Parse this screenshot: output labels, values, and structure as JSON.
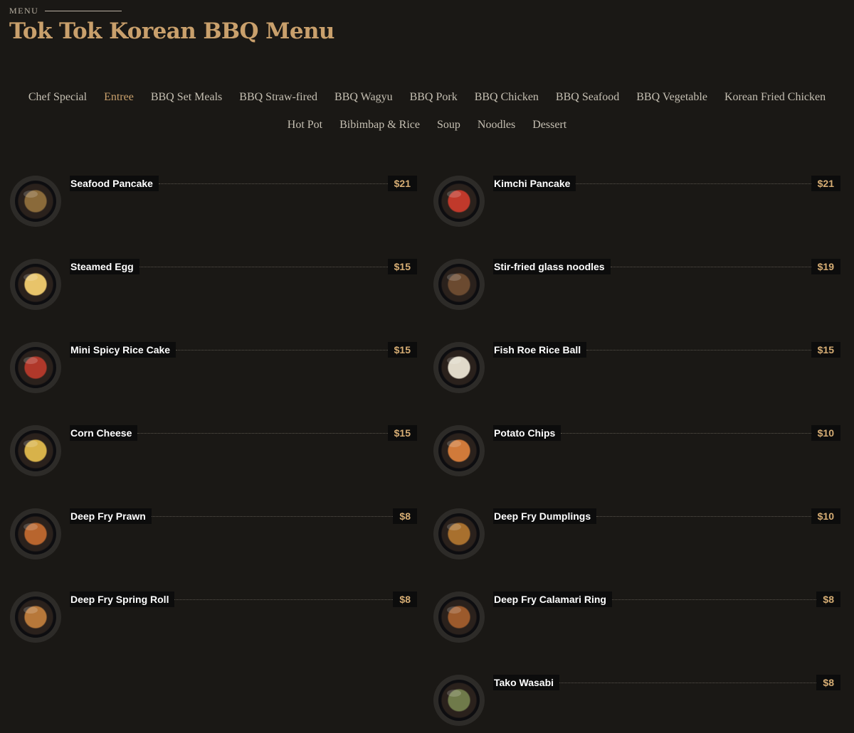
{
  "header": {
    "eyebrow": "MENU",
    "title": "Tok Tok Korean BBQ Menu"
  },
  "nav": {
    "row1": [
      "Chef Special",
      "Entree",
      "BBQ Set Meals",
      "BBQ Straw-fired",
      "BBQ Wagyu",
      "BBQ Pork",
      "BBQ Chicken",
      "BBQ Seafood",
      "BBQ Vegetable",
      "Korean Fried Chicken"
    ],
    "row2": [
      "Hot Pot",
      "Bibimbap & Rice",
      "Soup",
      "Noodles",
      "Dessert"
    ],
    "active": "Entree"
  },
  "items": [
    {
      "name": "Seafood Pancake",
      "price": "$21",
      "food": "#8a6a3a"
    },
    {
      "name": "Kimchi Pancake",
      "price": "$21",
      "food": "#c0392b"
    },
    {
      "name": "Steamed Egg",
      "price": "$15",
      "food": "#e8c46a"
    },
    {
      "name": "Stir-fried glass noodles",
      "price": "$19",
      "food": "#6b4a30"
    },
    {
      "name": "Mini Spicy Rice Cake",
      "price": "$15",
      "food": "#b0382a"
    },
    {
      "name": "Fish Roe Rice Ball",
      "price": "$15",
      "food": "#e0d9c9"
    },
    {
      "name": "Corn Cheese",
      "price": "$15",
      "food": "#d8b24a"
    },
    {
      "name": "Potato Chips",
      "price": "$10",
      "food": "#d07a3a"
    },
    {
      "name": "Deep Fry Prawn",
      "price": "$8",
      "food": "#b8652e"
    },
    {
      "name": "Deep Fry Dumplings",
      "price": "$10",
      "food": "#a8702e"
    },
    {
      "name": "Deep Fry Spring Roll",
      "price": "$8",
      "food": "#b7783a"
    },
    {
      "name": "Deep Fry Calamari Ring",
      "price": "$8",
      "food": "#9c5a2c"
    },
    {
      "name": "Tako Wasabi",
      "price": "$8",
      "food": "#6f7a4a"
    }
  ]
}
